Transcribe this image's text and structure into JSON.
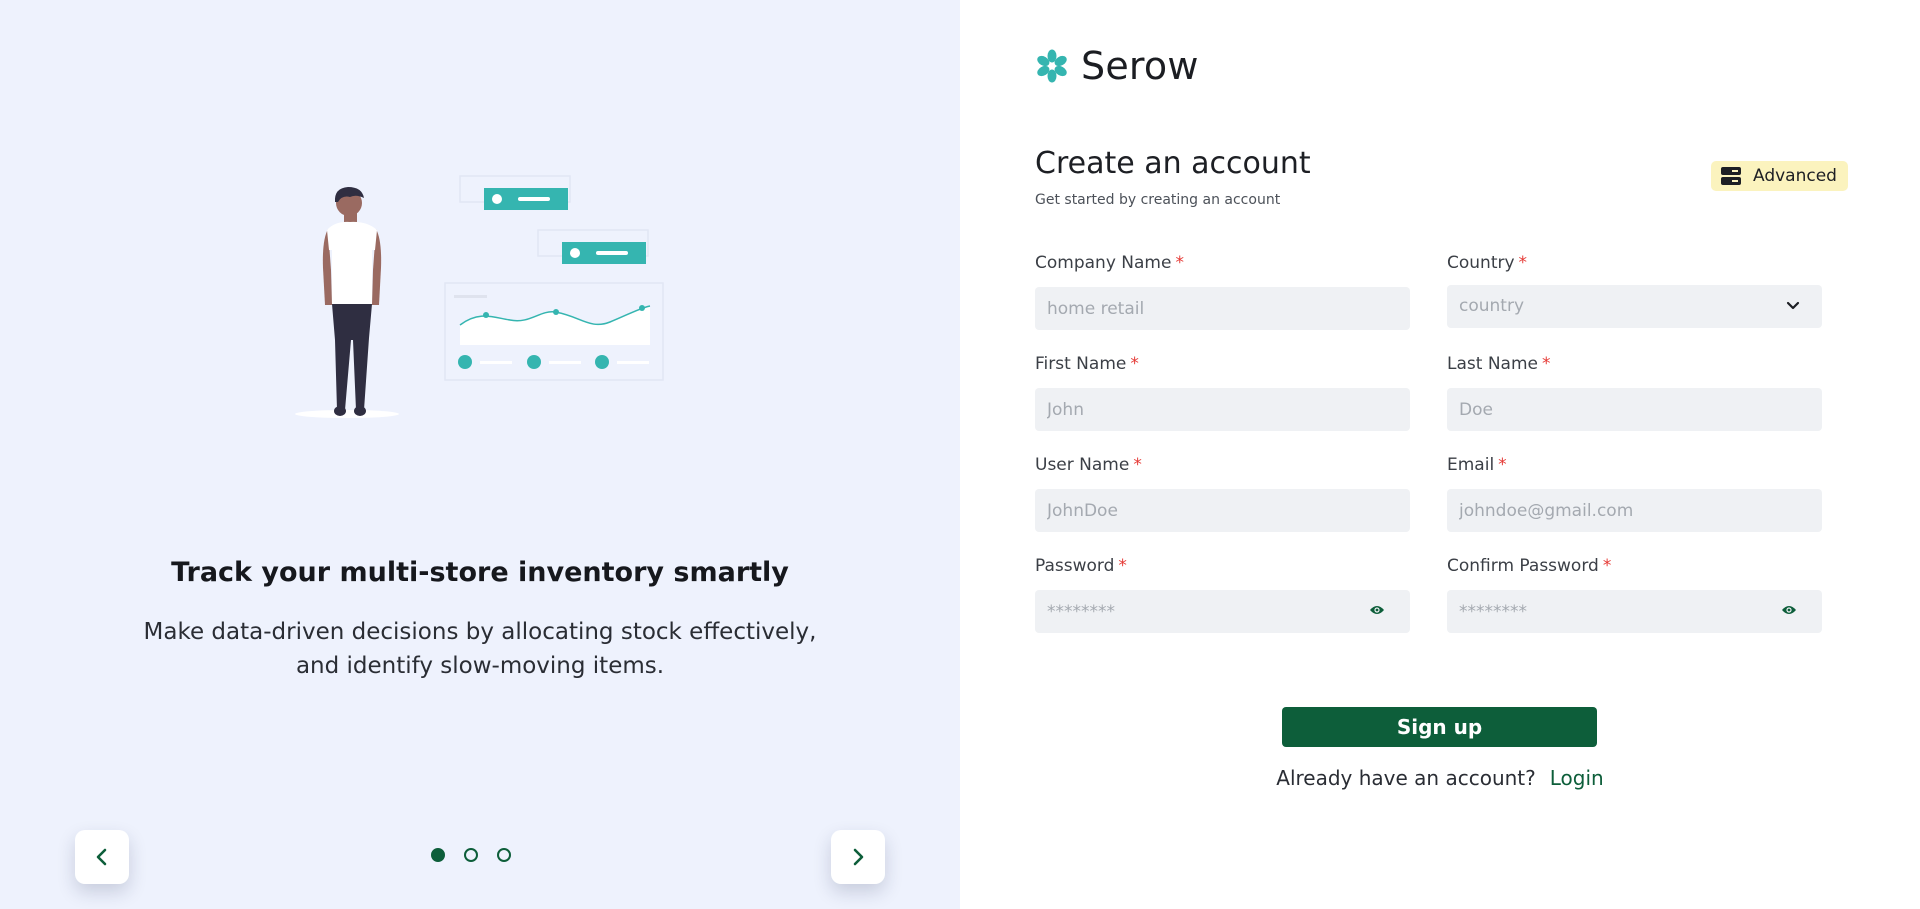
{
  "carousel": {
    "title": "Track your multi-store inventory smartly",
    "description": "Make data-driven decisions by allocating stock effectively, and identify slow-moving items.",
    "slides_total": 3,
    "active_slide": 1
  },
  "brand": {
    "name": "Serow",
    "logo_icon": "flower-logo-icon"
  },
  "form": {
    "heading": "Create an account",
    "subheading": "Get started by creating an account",
    "advanced_label": "Advanced",
    "required_marker": "*",
    "company": {
      "label": "Company Name",
      "placeholder": "home retail"
    },
    "country": {
      "label": "Country",
      "placeholder": "country"
    },
    "first_name": {
      "label": "First Name",
      "placeholder": "John"
    },
    "last_name": {
      "label": "Last Name",
      "placeholder": "Doe"
    },
    "user_name": {
      "label": "User Name",
      "placeholder": "JohnDoe"
    },
    "email": {
      "label": "Email",
      "placeholder": "johndoe@gmail.com"
    },
    "password": {
      "label": "Password",
      "placeholder": "********"
    },
    "confirm_password": {
      "label": "Confirm Password",
      "placeholder": "********"
    },
    "signup_label": "Sign up",
    "login_prompt": "Already have an account?",
    "login_link": "Login"
  },
  "colors": {
    "primary": "#0d5e3a",
    "accent_teal": "#35b5b0",
    "left_bg": "#eef2fd",
    "required": "#e53935",
    "advanced_bg": "#fbf3be"
  }
}
